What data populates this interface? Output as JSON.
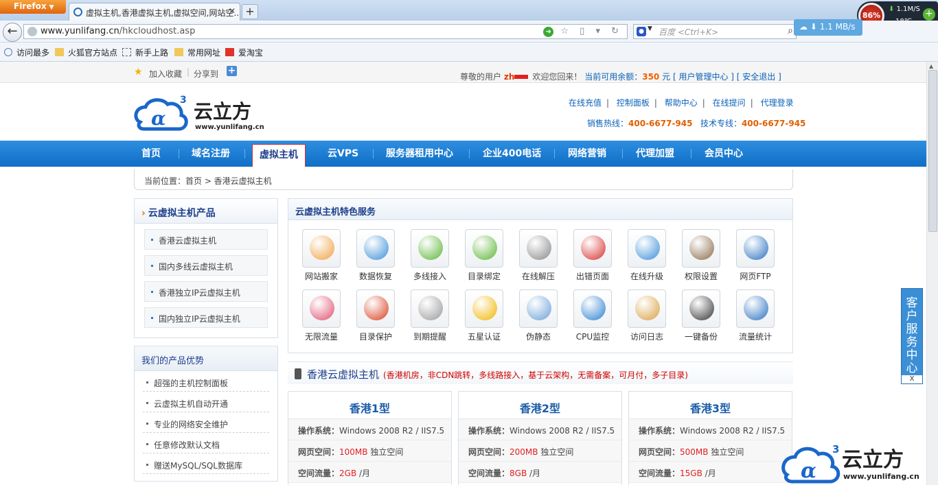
{
  "browser": {
    "app_button": "Firefox",
    "tab_title": "虚拟主机,香港虚拟主机,虚拟空间,网站空...",
    "url_host": "www.yunlifang.cn",
    "url_path": "/hkcloudhost.asp",
    "search_placeholder": "百度 <Ctrl+K>",
    "speed": "1.1 MB/s",
    "widget_percent": "86%",
    "widget_speed": "1.1M/S",
    "widget_temp": "18℃"
  },
  "bookmarks": [
    "访问最多",
    "火狐官方站点",
    "新手上路",
    "常用网址",
    "爱淘宝"
  ],
  "topbar": {
    "add_fav": "加入收藏",
    "share": "分享到",
    "greeting": "尊敬的用户",
    "username": "zh",
    "welcome": "欢迎您回来！",
    "balance_label": "当前可用余额：",
    "balance_value": "350",
    "balance_unit": "元",
    "manage": "[ 用户管理中心 ]",
    "logout": "[ 安全退出 ]"
  },
  "header": {
    "logo_text": "云立方",
    "logo_url": "www.yunlifang.cn",
    "links": [
      "在线充值",
      "控制面板",
      "帮助中心",
      "在线提问",
      "代理登录"
    ],
    "sales_label": "销售热线：",
    "sales_phone": "400-6677-945",
    "tech_label": "技术专线：",
    "tech_phone": "400-6677-945"
  },
  "nav": [
    "首页",
    "域名注册",
    "虚拟主机",
    "云VPS",
    "服务器租用中心",
    "企业400电话",
    "网络营销",
    "代理加盟",
    "会员中心"
  ],
  "breadcrumb": "当前位置：首页 > 香港云虚拟主机",
  "sidebar": {
    "products_title": "云虚拟主机产品",
    "products": [
      "香港云虚拟主机",
      "国内多线云虚拟主机",
      "香港独立IP云虚拟主机",
      "国内独立IP云虚拟主机"
    ],
    "adv_title": "我们的产品优势",
    "advantages": [
      "超强的主机控制面板",
      "云虚拟主机自动开通",
      "专业的网络安全维护",
      "任意修改默认文档",
      "赠送MySQL/SQL数据库"
    ]
  },
  "features": {
    "title": "云虚拟主机特色服务",
    "items": [
      "网站搬家",
      "数据恢复",
      "多线接入",
      "目录绑定",
      "在线解压",
      "出错页面",
      "在线升级",
      "权限设置",
      "网页FTP",
      "无限流量",
      "目录保护",
      "到期提醒",
      "五星认证",
      "伪静态",
      "CPU监控",
      "访问日志",
      "一键备份",
      "流量统计"
    ]
  },
  "hk": {
    "title": "香港云虚拟主机",
    "desc": "(香港机房，非CDN跳转，多线路接入，基于云架构，无需备案，可月付，多子目录)",
    "plans": [
      {
        "name": "香港1型",
        "os_label": "操作系统：",
        "os": "Windows 2008 R2 / IIS7.5",
        "space_label": "网页空间：",
        "space": "100MB",
        "space_suffix": "独立空间",
        "traffic_label": "空间流量：",
        "traffic": "2GB",
        "traffic_suffix": "/月"
      },
      {
        "name": "香港2型",
        "os_label": "操作系统：",
        "os": "Windows 2008 R2 / IIS7.5",
        "space_label": "网页空间：",
        "space": "200MB",
        "space_suffix": "独立空间",
        "traffic_label": "空间流量：",
        "traffic": "8GB",
        "traffic_suffix": "/月"
      },
      {
        "name": "香港3型",
        "os_label": "操作系统：",
        "os": "Windows 2008 R2 / IIS7.5",
        "space_label": "网页空间：",
        "space": "500MB",
        "space_suffix": "独立空间",
        "traffic_label": "空间流量：",
        "traffic": "15GB",
        "traffic_suffix": "/月"
      }
    ]
  },
  "service_float": {
    "label": "客户服务中心",
    "close": "X"
  }
}
